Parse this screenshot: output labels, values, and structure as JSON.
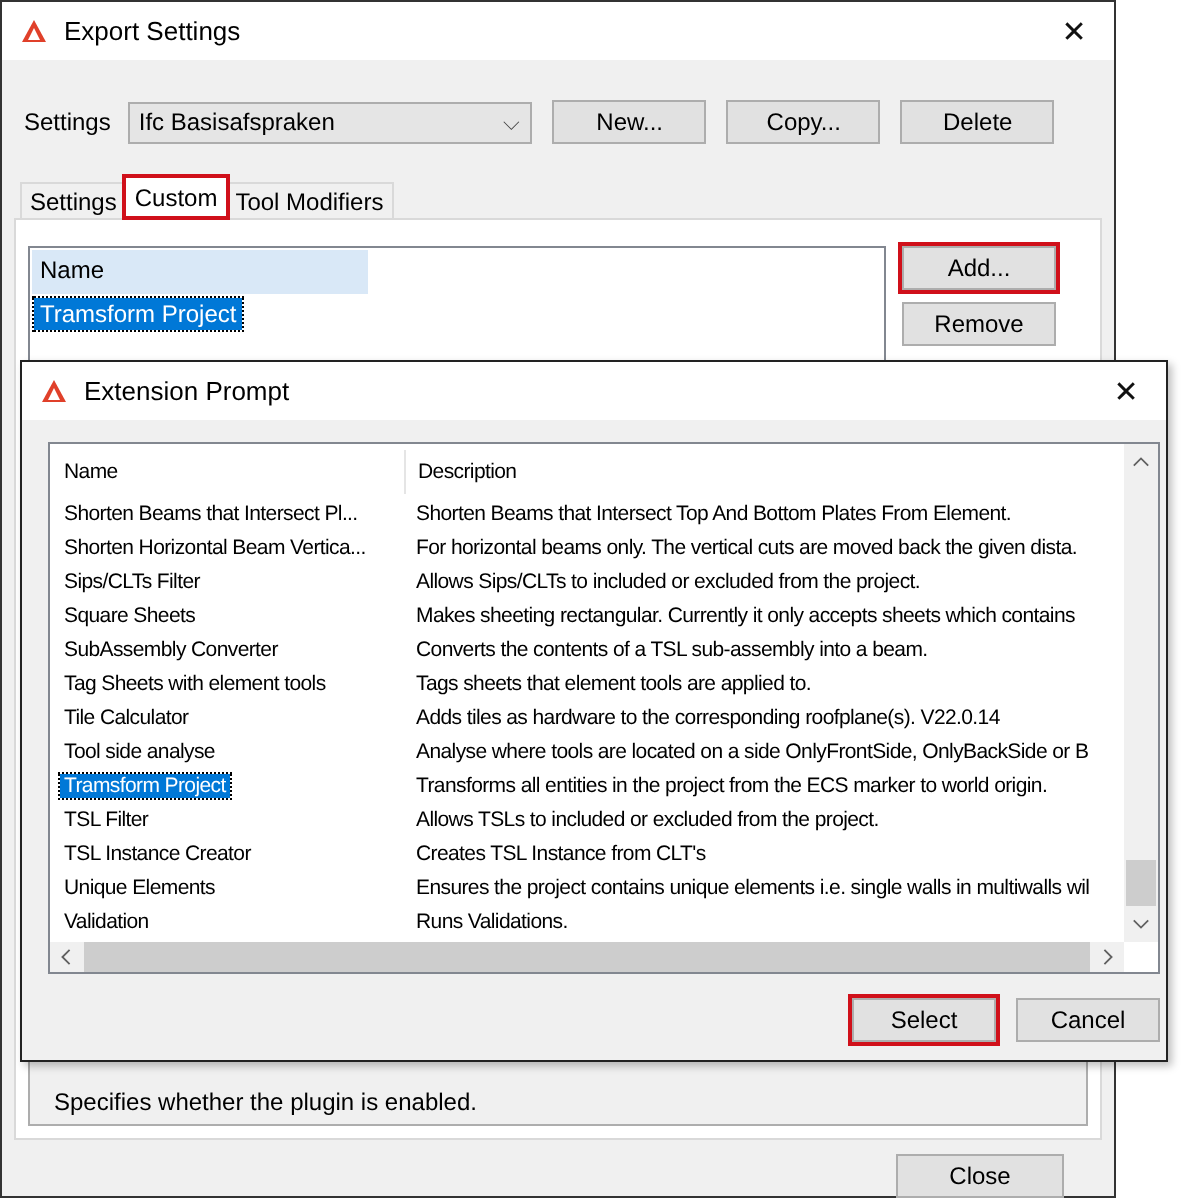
{
  "window": {
    "title": "Export Settings",
    "close": "✕"
  },
  "settings": {
    "label": "Settings",
    "value": "Ifc Basisafspraken",
    "caret": "⌵"
  },
  "top_buttons": [
    {
      "label": "New...",
      "highlighted": false
    },
    {
      "label": "Copy...",
      "highlighted": false
    },
    {
      "label": "Delete",
      "highlighted": false
    }
  ],
  "tabs": [
    {
      "label": "Settings",
      "selected": false,
      "highlighted": false
    },
    {
      "label": "Custom",
      "selected": true,
      "highlighted": true
    },
    {
      "label": "Tool Modifiers",
      "selected": false,
      "highlighted": false
    }
  ],
  "custom_list": {
    "header": "Name",
    "rows": [
      {
        "name": "Tramsform Project",
        "selected": true
      }
    ]
  },
  "side_buttons": [
    {
      "label": "Add...",
      "highlighted": true
    },
    {
      "label": "Remove",
      "highlighted": false
    }
  ],
  "description": "Specifies whether the plugin is enabled.",
  "close_button": "Close",
  "dialog": {
    "title": "Extension Prompt",
    "close": "✕",
    "columns": [
      "Name",
      "Description"
    ],
    "rows": [
      {
        "name": "Shorten Beams that Intersect Pl...",
        "description": "Shorten Beams that Intersect Top And Bottom Plates From Element.",
        "selected": false
      },
      {
        "name": "Shorten Horizontal Beam Vertica...",
        "description": "For horizontal beams only. The vertical cuts are moved back the given dista.",
        "selected": false
      },
      {
        "name": "Sips/CLTs Filter",
        "description": "Allows Sips/CLTs to included or excluded from the project.",
        "selected": false
      },
      {
        "name": "Square Sheets",
        "description": "Makes sheeting rectangular. Currently it only accepts sheets which contains",
        "selected": false
      },
      {
        "name": "SubAssembly Converter",
        "description": "Converts the contents of a TSL sub-assembly into a beam.",
        "selected": false
      },
      {
        "name": "Tag Sheets with element tools",
        "description": "Tags sheets that element tools are applied to.",
        "selected": false
      },
      {
        "name": "Tile Calculator",
        "description": "Adds tiles as hardware to the corresponding roofplane(s). V22.0.14",
        "selected": false
      },
      {
        "name": "Tool side analyse",
        "description": "Analyse where tools are located on a side OnlyFrontSide, OnlyBackSide or B",
        "selected": false
      },
      {
        "name": "Tramsform Project",
        "description": "Transforms all entities in the project from the ECS marker to world origin.",
        "selected": true
      },
      {
        "name": "TSL Filter",
        "description": "Allows TSLs to included or excluded from the project.",
        "selected": false
      },
      {
        "name": "TSL Instance Creator",
        "description": "Creates TSL Instance from CLT's",
        "selected": false
      },
      {
        "name": "Unique Elements",
        "description": "Ensures the project contains unique elements i.e. single walls in multiwalls wil",
        "selected": false
      },
      {
        "name": "Validation",
        "description": "Runs Validations.",
        "selected": false
      }
    ],
    "buttons": [
      {
        "label": "Select",
        "highlighted": true
      },
      {
        "label": "Cancel",
        "highlighted": false
      }
    ]
  }
}
